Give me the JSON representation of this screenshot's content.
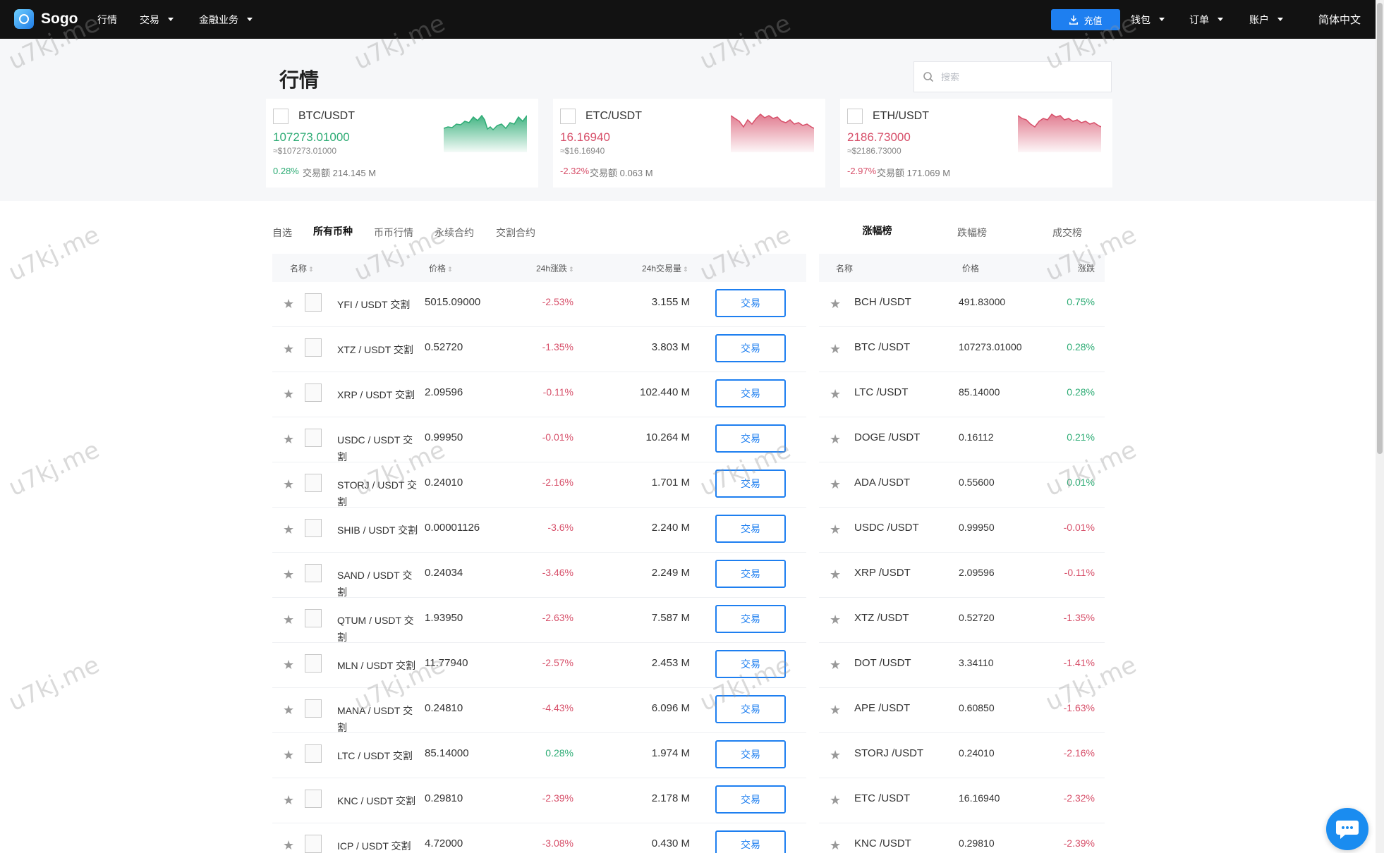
{
  "brand": {
    "name": "Sogo"
  },
  "nav": {
    "items": [
      "行情",
      "交易",
      "金融业务"
    ],
    "deposit_label": "充值",
    "right_items": [
      "钱包",
      "订单",
      "账户"
    ],
    "language": "简体中文"
  },
  "page": {
    "title": "行情",
    "search_placeholder": "搜索"
  },
  "tickers": [
    {
      "pair": "BTC/USDT",
      "price": "107273.01000",
      "usd": "≈$107273.01000",
      "change": "0.28%",
      "volume": "交易额 214.145 M",
      "trend": "up"
    },
    {
      "pair": "ETC/USDT",
      "price": "16.16940",
      "usd": "≈$16.16940",
      "change": "-2.32%",
      "volume": "交易额 0.063 M",
      "trend": "down"
    },
    {
      "pair": "ETH/USDT",
      "price": "2186.73000",
      "usd": "≈$2186.73000",
      "change": "-2.97%",
      "volume": "交易额 171.069 M",
      "trend": "down"
    }
  ],
  "market_tabs": [
    "自选",
    "所有币种",
    "币币行情",
    "永续合约",
    "交割合约"
  ],
  "market_active_tab": "所有币种",
  "table": {
    "headers": {
      "name": "名称",
      "price": "价格",
      "change": "24h涨跌",
      "volume": "24h交易量"
    },
    "trade_label": "交易",
    "rows": [
      {
        "pair": "YFI / USDT 交割",
        "price": "5015.09000",
        "change": "-2.53%",
        "volume": "3.155 M"
      },
      {
        "pair": "XTZ / USDT 交割",
        "price": "0.52720",
        "change": "-1.35%",
        "volume": "3.803 M"
      },
      {
        "pair": "XRP / USDT 交割",
        "price": "2.09596",
        "change": "-0.11%",
        "volume": "102.440 M"
      },
      {
        "pair": "USDC / USDT 交割",
        "price": "0.99950",
        "change": "-0.01%",
        "volume": "10.264 M"
      },
      {
        "pair": "STORJ / USDT 交割",
        "price": "0.24010",
        "change": "-2.16%",
        "volume": "1.701 M"
      },
      {
        "pair": "SHIB / USDT 交割",
        "price": "0.00001126",
        "change": "-3.6%",
        "volume": "2.240 M"
      },
      {
        "pair": "SAND / USDT 交割",
        "price": "0.24034",
        "change": "-3.46%",
        "volume": "2.249 M"
      },
      {
        "pair": "QTUM / USDT 交割",
        "price": "1.93950",
        "change": "-2.63%",
        "volume": "7.587 M"
      },
      {
        "pair": "MLN / USDT 交割",
        "price": "11.77940",
        "change": "-2.57%",
        "volume": "2.453 M"
      },
      {
        "pair": "MANA / USDT 交割",
        "price": "0.24810",
        "change": "-4.43%",
        "volume": "6.096 M"
      },
      {
        "pair": "LTC / USDT 交割",
        "price": "85.14000",
        "change": "0.28%",
        "volume": "1.974 M"
      },
      {
        "pair": "KNC / USDT 交割",
        "price": "0.29810",
        "change": "-2.39%",
        "volume": "2.178 M"
      },
      {
        "pair": "ICP / USDT 交割",
        "price": "4.72000",
        "change": "-3.08%",
        "volume": "0.430 M"
      }
    ]
  },
  "ranking": {
    "tabs": [
      "涨幅榜",
      "跌幅榜",
      "成交榜"
    ],
    "active_tab": "涨幅榜",
    "headers": {
      "name": "名称",
      "price": "价格",
      "change": "涨跌"
    },
    "rows": [
      {
        "pair": "BCH /USDT",
        "price": "491.83000",
        "change": "0.75%"
      },
      {
        "pair": "BTC /USDT",
        "price": "107273.01000",
        "change": "0.28%"
      },
      {
        "pair": "LTC /USDT",
        "price": "85.14000",
        "change": "0.28%"
      },
      {
        "pair": "DOGE /USDT",
        "price": "0.16112",
        "change": "0.21%"
      },
      {
        "pair": "ADA /USDT",
        "price": "0.55600",
        "change": "0.01%"
      },
      {
        "pair": "USDC /USDT",
        "price": "0.99950",
        "change": "-0.01%"
      },
      {
        "pair": "XRP /USDT",
        "price": "2.09596",
        "change": "-0.11%"
      },
      {
        "pair": "XTZ /USDT",
        "price": "0.52720",
        "change": "-1.35%"
      },
      {
        "pair": "DOT /USDT",
        "price": "3.34110",
        "change": "-1.41%"
      },
      {
        "pair": "APE /USDT",
        "price": "0.60850",
        "change": "-1.63%"
      },
      {
        "pair": "STORJ /USDT",
        "price": "0.24010",
        "change": "-2.16%"
      },
      {
        "pair": "ETC /USDT",
        "price": "16.16940",
        "change": "-2.32%"
      },
      {
        "pair": "KNC /USDT",
        "price": "0.29810",
        "change": "-2.39%"
      }
    ]
  },
  "colors": {
    "accent": "#1e7ff0",
    "up": "#2eac75",
    "down": "#d7506a",
    "topbar": "#121212"
  },
  "watermark": "u7kj.me"
}
